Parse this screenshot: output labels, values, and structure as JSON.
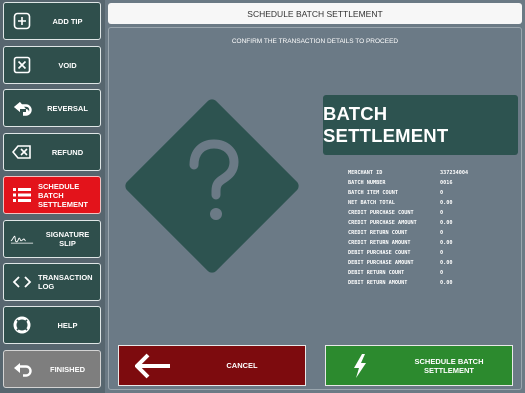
{
  "sidebar": {
    "items": [
      {
        "label": "ADD TIP",
        "icon": "plus-square-icon"
      },
      {
        "label": "VOID",
        "icon": "x-square-icon"
      },
      {
        "label": "REVERSAL",
        "icon": "reverse-arrow-icon"
      },
      {
        "label": "REFUND",
        "icon": "backspace-icon"
      },
      {
        "label": "SCHEDULE\nBATCH\nSETTLEMENT",
        "icon": "list-icon"
      },
      {
        "label": "SIGNATURE SLIP",
        "icon": "signature-icon"
      },
      {
        "label": "TRANSACTION\nLOG",
        "icon": "code-brackets-icon"
      },
      {
        "label": "HELP",
        "icon": "lifebuoy-icon"
      },
      {
        "label": "FINISHED",
        "icon": "return-arrow-icon"
      }
    ],
    "active_index": 4
  },
  "header": {
    "title": "SCHEDULE BATCH SETTLEMENT"
  },
  "main": {
    "subtitle": "CONFIRM THE TRANSACTION DETAILS TO PROCEED",
    "banner": "BATCH SETTLEMENT",
    "icon": "question-diamond-icon",
    "details": [
      {
        "label": "MERCHANT ID",
        "value": "337234004"
      },
      {
        "label": "BATCH NUMBER",
        "value": "0016"
      },
      {
        "label": "BATCH ITEM COUNT",
        "value": "0"
      },
      {
        "label": "NET BATCH TOTAL",
        "value": "0.00"
      },
      {
        "label": "CREDIT PURCHASE COUNT",
        "value": "0"
      },
      {
        "label": "CREDIT PURCHASE AMOUNT",
        "value": "0.00"
      },
      {
        "label": "CREDIT RETURN COUNT",
        "value": "0"
      },
      {
        "label": "CREDIT RETURN AMOUNT",
        "value": "0.00"
      },
      {
        "label": "DEBIT PURCHASE COUNT",
        "value": "0"
      },
      {
        "label": "DEBIT PURCHASE AMOUNT",
        "value": "0.00"
      },
      {
        "label": "DEBIT RETURN COUNT",
        "value": "0"
      },
      {
        "label": "DEBIT RETURN AMOUNT",
        "value": "0.00"
      }
    ]
  },
  "actions": {
    "cancel_label": "CANCEL",
    "confirm_label": "SCHEDULE BATCH\nSETTLEMENT"
  },
  "colors": {
    "accent_active": "#e3131b",
    "button_dark": "#2f4f4c",
    "cancel": "#7d0b0e",
    "confirm": "#2c8a2e"
  }
}
